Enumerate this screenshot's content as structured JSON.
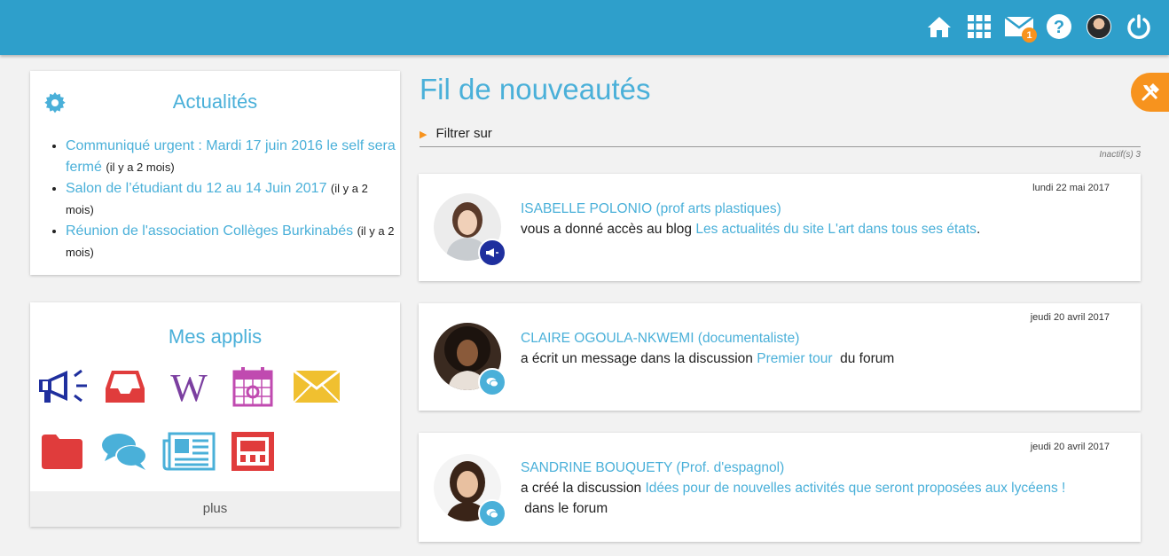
{
  "header": {
    "icons": [
      "home-icon",
      "apps-grid-icon",
      "mail-icon",
      "help-icon",
      "user-avatar",
      "power-icon"
    ],
    "mail_badge": "1"
  },
  "news": {
    "title": "Actualités",
    "items": [
      {
        "link": "Communiqué urgent : Mardi 17 juin 2016 le self sera fermé",
        "ago": "(il y a 2 mois)"
      },
      {
        "link": "Salon de l’étudiant du 12 au 14 Juin 2017",
        "ago": "(il y a 2 mois)"
      },
      {
        "link": "Réunion de l'association Collèges Burkinabés",
        "ago": "(il y a 2 mois)"
      }
    ]
  },
  "apps": {
    "title": "Mes applis",
    "items": [
      "megaphone-icon",
      "inbox-icon",
      "wiki-icon",
      "calendar-icon",
      "mail-icon",
      "folder-icon",
      "chat-icon",
      "newspaper-icon",
      "pages-icon"
    ],
    "more_label": "plus",
    "colors": {
      "blue": "#1f2f9e",
      "red": "#e03c3c",
      "purple": "#7b3fa0",
      "pink": "#c04ab0",
      "yellow": "#f0c030",
      "light_blue": "#4ab0d9"
    }
  },
  "feed": {
    "title": "Fil de nouveautés",
    "filter_label": "Filtrer sur",
    "inactive_label": "Inactif(s) 3",
    "entries": [
      {
        "date": "lundi 22 mai 2017",
        "author": "ISABELLE POLONIO (prof arts plastiques)",
        "text_before": "vous a donné accès au blog ",
        "link": "Les actualités du site L'art dans tous ses états",
        "text_after": ".",
        "badge": "megaphone-icon"
      },
      {
        "date": "jeudi 20 avril 2017",
        "author": "CLAIRE OGOULA-NKWEMI (documentaliste)",
        "text_before": "a écrit un message dans la discussion ",
        "link": "Premier tour",
        "text_after": "  du forum",
        "badge": "chat-icon"
      },
      {
        "date": "jeudi 20 avril 2017",
        "author": "SANDRINE BOUQUETY (Prof. d'espagnol)",
        "text_before": "a créé la discussion ",
        "link": "Idées pour de nouvelles activités que seront proposées aux lycéens !",
        "text_after": " dans le forum",
        "badge": "chat-icon"
      }
    ]
  },
  "accent_color": "#2e9fcb",
  "orange_color": "#f7931e"
}
